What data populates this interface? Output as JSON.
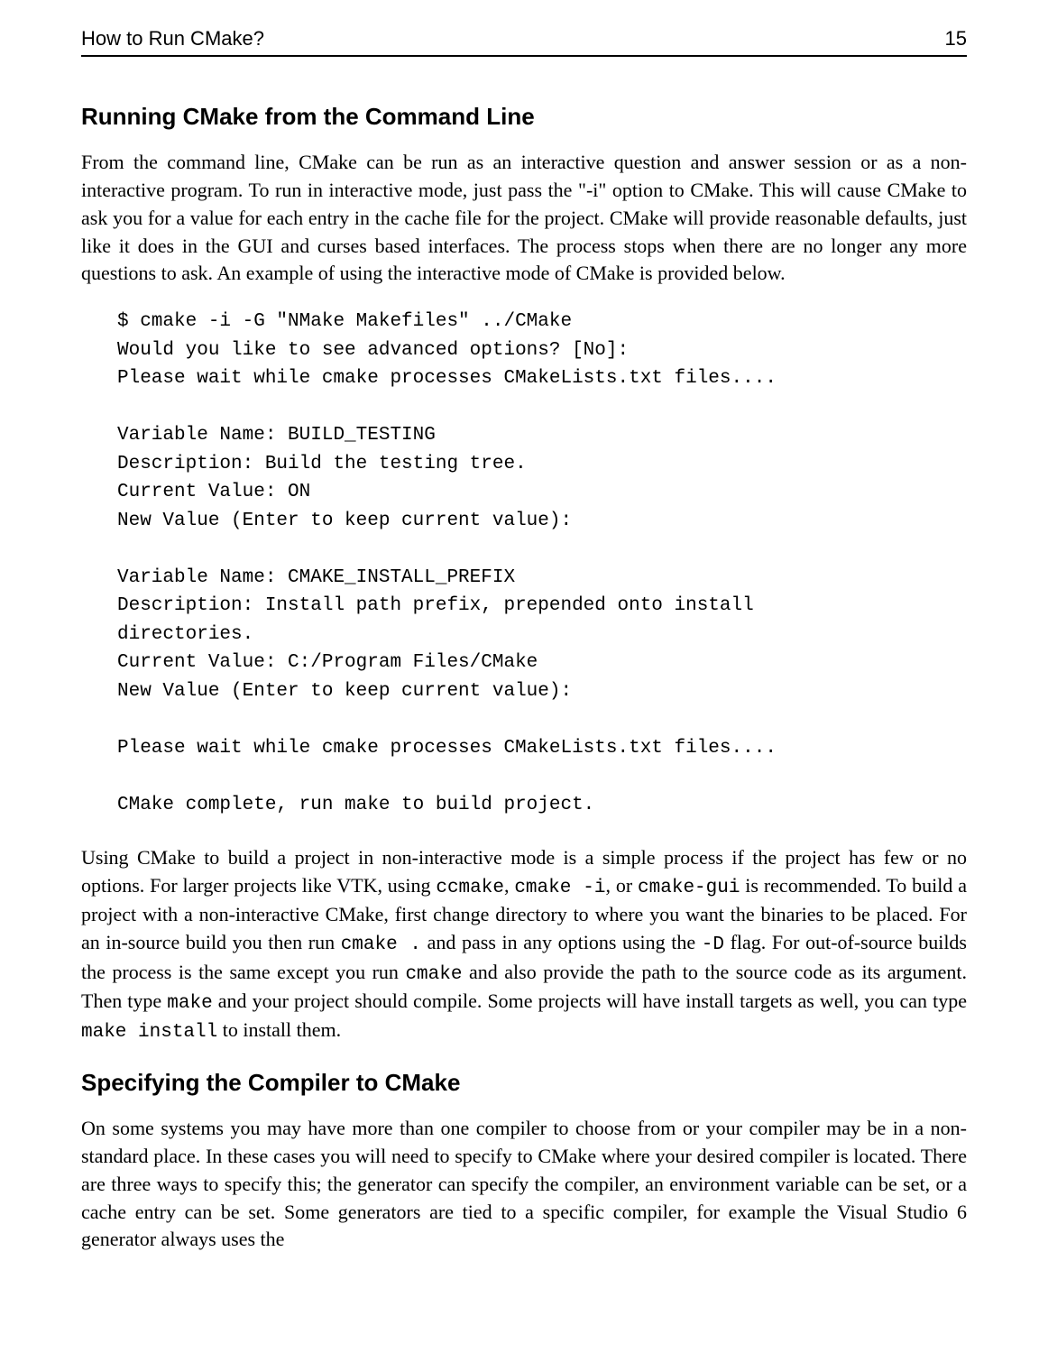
{
  "header": {
    "title": "How to Run CMake?",
    "page_number": "15"
  },
  "section1": {
    "heading": "Running CMake from the Command Line",
    "para1": "From the command line, CMake can be run as an interactive question and answer session or as a non-interactive program. To run in interactive mode, just pass the \"-i\" option to CMake. This will cause CMake to ask you for a value for each entry in the cache file for the project. CMake will provide reasonable defaults, just like it does in the GUI and curses based interfaces. The process stops when there are no longer any more questions to ask. An example of using the interactive mode of CMake is provided below.",
    "code": "$ cmake -i -G \"NMake Makefiles\" ../CMake\nWould you like to see advanced options? [No]:\nPlease wait while cmake processes CMakeLists.txt files....\n\nVariable Name: BUILD_TESTING\nDescription: Build the testing tree.\nCurrent Value: ON\nNew Value (Enter to keep current value):\n\nVariable Name: CMAKE_INSTALL_PREFIX\nDescription: Install path prefix, prepended onto install\ndirectories.\nCurrent Value: C:/Program Files/CMake\nNew Value (Enter to keep current value):\n\nPlease wait while cmake processes CMakeLists.txt files....\n\nCMake complete, run make to build project.",
    "para2_a": "Using CMake to build a project in non-interactive mode is a simple process if the project has few or no options. For larger projects like VTK, using ",
    "code_ccmake": "ccmake",
    "para2_b": ", ",
    "code_cmake_i": "cmake -i",
    "para2_c": ", or ",
    "code_cmake_gui": "cmake-gui",
    "para2_d": " is recommended. To build a project with a non-interactive CMake, first change directory to where you want the binaries to be placed. For an in-source build you then run ",
    "code_cmake_dot": "cmake .",
    "para2_e": " and pass in any options using the ",
    "code_dashD": "-D",
    "para2_f": " flag. For out-of-source builds the process is the same except you run ",
    "code_cmake": "cmake",
    "para2_g": " and also provide the path to the source code as its argument. Then type ",
    "code_make": "make",
    "para2_h": " and your project should compile. Some projects will have install targets as well, you can type ",
    "code_make_install": "make install",
    "para2_i": " to install them."
  },
  "section2": {
    "heading": "Specifying the Compiler to CMake",
    "para1": "On some systems you may have more than one compiler to choose from or your compiler may be in a non-standard place. In these cases you will need to specify to CMake where your desired compiler is located. There are three ways to specify this; the generator can specify the compiler, an environment variable can be set, or a cache entry can be set. Some generators are tied to a specific compiler, for example the Visual Studio 6 generator always uses the"
  }
}
